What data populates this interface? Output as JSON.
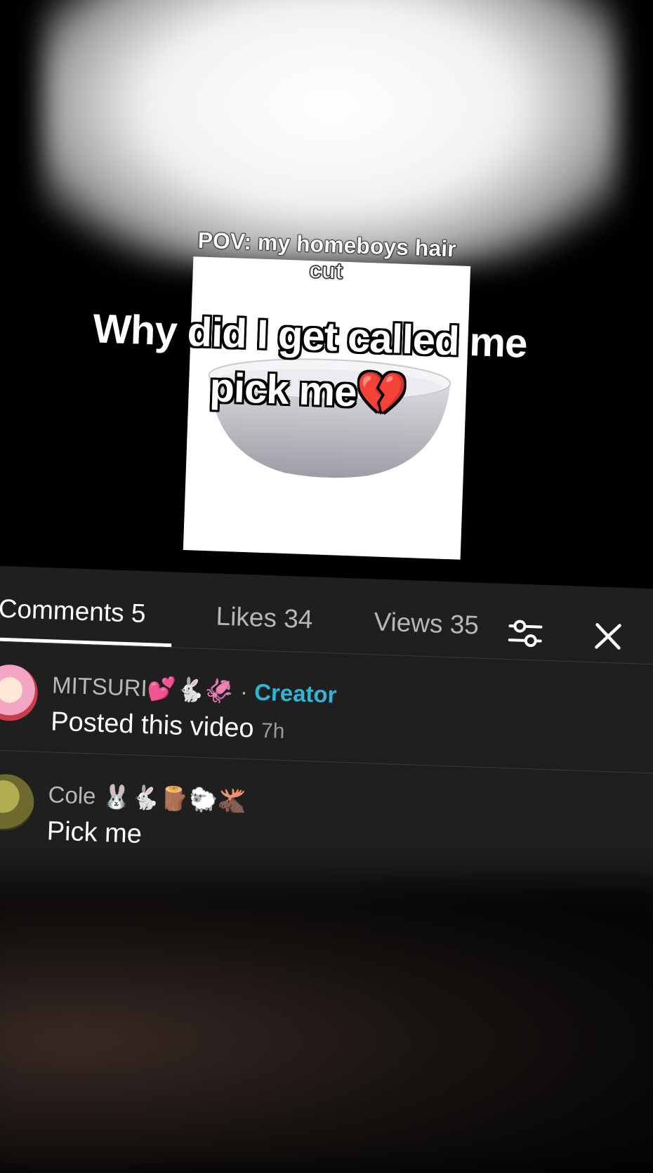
{
  "video": {
    "meme_caption_line1": "POV: my homeboys hair",
    "meme_caption_line2": "cut",
    "overlay_text_line1": "Why did I get called me",
    "overlay_text_line2": "pick me💔"
  },
  "tabs": [
    {
      "label": "Comments 5",
      "active": true
    },
    {
      "label": "Likes 34",
      "active": false
    },
    {
      "label": "Views 35",
      "active": false
    }
  ],
  "icons": {
    "filter": "sliders-icon",
    "close": "close-icon"
  },
  "comments": [
    {
      "username": "MITSURI💕🐇🦑",
      "separator": "·",
      "badge": "Creator",
      "text": "Posted this video",
      "time": "7h",
      "avatar_color": "#f2a6c4"
    },
    {
      "username": "Cole 🐰🐇🪵🐑🫎",
      "text": "Pick me",
      "avatar_color": "#6e6a2e"
    }
  ],
  "colors": {
    "creator": "#2fb6d6",
    "panel": "#1f1f1f"
  }
}
